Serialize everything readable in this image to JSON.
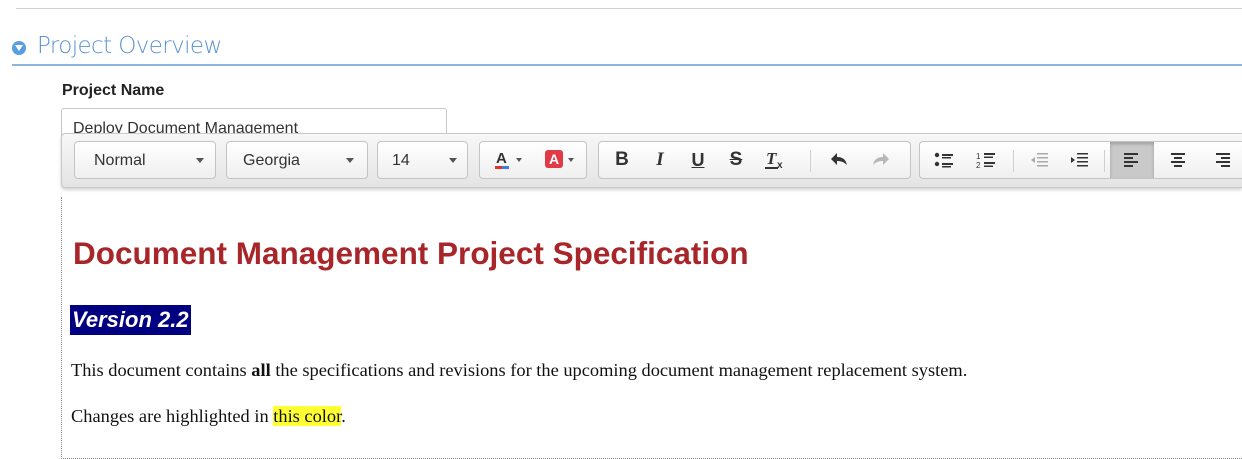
{
  "section": {
    "title": "Project Overview"
  },
  "field": {
    "label": "Project Name",
    "value": "Deploy Document Management"
  },
  "toolbar": {
    "format_select": "Normal",
    "font_select": "Georgia",
    "size_select": "14",
    "text_color_icon": "text-color-icon",
    "bg_color_icon": "background-color-icon",
    "bold": "B",
    "italic": "I",
    "underline": "U",
    "strike": "S",
    "clear_format": "Tx"
  },
  "document": {
    "heading": "Document Management Project Specification",
    "version": "Version 2.2",
    "p1_before": "This document contains ",
    "p1_bold": "all",
    "p1_after": " the specifications and revisions for the upcoming document management replacement system.",
    "p2_before": "Changes are highlighted in ",
    "p2_highlight": "this color",
    "p2_after": "."
  },
  "colors": {
    "heading": "#a8262a",
    "version_bg": "#000080",
    "highlight": "#ffff33",
    "section_title": "#5a93d0",
    "text_color_underline": "#e0322f",
    "bg_color_swatch": "#e03a47"
  }
}
